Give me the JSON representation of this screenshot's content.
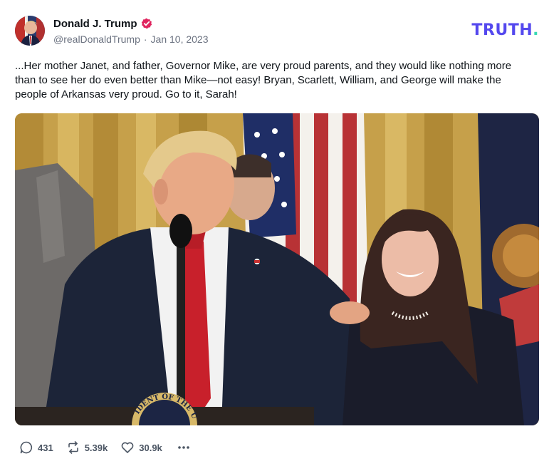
{
  "author": {
    "display_name": "Donald J. Trump",
    "handle": "@realDonaldTrump",
    "separator": "·",
    "date": "Jan 10, 2023",
    "verified": true
  },
  "brand": {
    "name": "TRUTH",
    "dot": ".",
    "primary_color": "#5448ee",
    "dot_color": "#38d9b4"
  },
  "post": {
    "text": "...Her mother Janet, and father, Governor Mike, are very proud parents, and they would like nothing more than to see her do even better than Mike—not easy! Bryan, Scarlett, William, and George will make the people of Arkansas very proud. Go to it, Sarah!"
  },
  "media": {
    "seal_text": "IDENT OF THE U"
  },
  "actions": {
    "replies": "431",
    "retruths": "5.39k",
    "likes": "30.9k",
    "reply_icon": "reply-bubble-icon",
    "retruth_icon": "retruth-arrows-icon",
    "like_icon": "heart-icon",
    "more_icon": "more-dots-icon"
  },
  "colors": {
    "verified_badge": "#e0245e",
    "text": "#0f1419",
    "muted": "#6b7280"
  }
}
